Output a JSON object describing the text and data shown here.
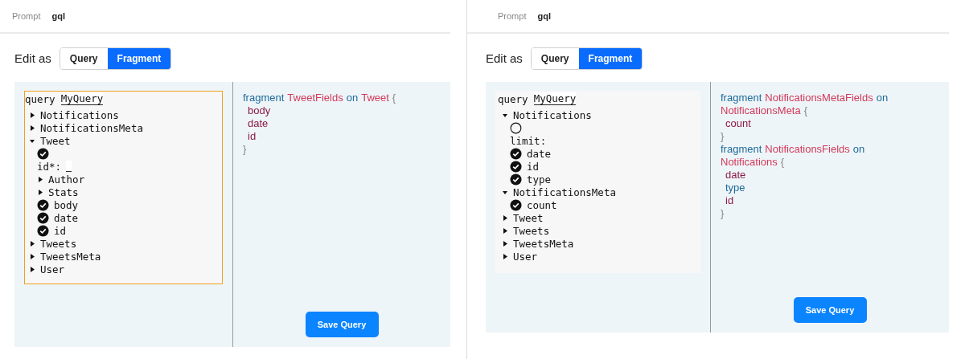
{
  "panels": [
    {
      "header": {
        "label": "Prompt",
        "value": "gql"
      },
      "edit_as": "Edit as",
      "tabs": [
        {
          "label": "Query",
          "selected": false
        },
        {
          "label": "Fragment",
          "selected": true
        }
      ],
      "explorer": {
        "keyword": "query",
        "name": "MyQuery",
        "focused": true,
        "nodes": [
          {
            "kind": "field",
            "label": "Notifications",
            "expanded": false
          },
          {
            "kind": "field",
            "label": "NotificationsMeta",
            "expanded": false
          },
          {
            "kind": "field",
            "label": "Tweet",
            "expanded": true,
            "children": [
              {
                "kind": "toggle",
                "checked": true
              },
              {
                "kind": "arg",
                "label": "id*:",
                "input": true
              },
              {
                "kind": "field",
                "label": "Author",
                "expanded": false
              },
              {
                "kind": "field",
                "label": "Stats",
                "expanded": false
              },
              {
                "kind": "leaf",
                "label": "body",
                "checked": true
              },
              {
                "kind": "leaf",
                "label": "date",
                "checked": true
              },
              {
                "kind": "leaf",
                "label": "id",
                "checked": true
              }
            ]
          },
          {
            "kind": "field",
            "label": "Tweets",
            "expanded": false
          },
          {
            "kind": "field",
            "label": "TweetsMeta",
            "expanded": false
          },
          {
            "kind": "field",
            "label": "User",
            "expanded": false
          }
        ]
      },
      "code": [
        [
          {
            "kind": "keyword",
            "text": "fragment"
          },
          {
            "kind": "name",
            "text": "TweetFields"
          },
          {
            "kind": "keyword",
            "text": "on"
          },
          {
            "kind": "name",
            "text": "Tweet"
          },
          {
            "kind": "punct",
            "text": "{"
          }
        ],
        [
          {
            "kind": "field",
            "text": "body"
          }
        ],
        [
          {
            "kind": "field",
            "text": "date"
          }
        ],
        [
          {
            "kind": "field",
            "text": "id"
          }
        ],
        [
          {
            "kind": "punct",
            "text": "}"
          }
        ]
      ],
      "save": "Save Query"
    },
    {
      "header": {
        "label": "Prompt",
        "value": "gql"
      },
      "edit_as": "Edit as",
      "tabs": [
        {
          "label": "Query",
          "selected": false
        },
        {
          "label": "Fragment",
          "selected": true
        }
      ],
      "explorer": {
        "keyword": "query",
        "name": "MyQuery",
        "focused": false,
        "nodes": [
          {
            "kind": "field",
            "label": "Notifications",
            "expanded": true,
            "children": [
              {
                "kind": "toggle",
                "checked": false
              },
              {
                "kind": "arg",
                "label": "limit:",
                "input": false
              },
              {
                "kind": "leaf",
                "label": "date",
                "checked": true
              },
              {
                "kind": "leaf",
                "label": "id",
                "checked": true
              },
              {
                "kind": "leaf",
                "label": "type",
                "checked": true
              }
            ]
          },
          {
            "kind": "field",
            "label": "NotificationsMeta",
            "expanded": true,
            "children": [
              {
                "kind": "leaf",
                "label": "count",
                "checked": true
              }
            ]
          },
          {
            "kind": "field",
            "label": "Tweet",
            "expanded": false
          },
          {
            "kind": "field",
            "label": "Tweets",
            "expanded": false
          },
          {
            "kind": "field",
            "label": "TweetsMeta",
            "expanded": false
          },
          {
            "kind": "field",
            "label": "User",
            "expanded": false
          }
        ]
      },
      "code": [
        [
          {
            "kind": "keyword",
            "text": "fragment"
          },
          {
            "kind": "name",
            "text": "NotificationsMetaFields"
          },
          {
            "kind": "keyword",
            "text": "on"
          }
        ],
        [
          {
            "kind": "name",
            "text": "NotificationsMeta"
          },
          {
            "kind": "punct",
            "text": "{"
          }
        ],
        [
          {
            "kind": "field",
            "text": "count"
          }
        ],
        [
          {
            "kind": "punct",
            "text": "}"
          }
        ],
        [
          {
            "kind": "keyword",
            "text": "fragment"
          },
          {
            "kind": "name",
            "text": "NotificationsFields"
          },
          {
            "kind": "keyword",
            "text": "on"
          }
        ],
        [
          {
            "kind": "name",
            "text": "Notifications"
          },
          {
            "kind": "punct",
            "text": "{"
          }
        ],
        [
          {
            "kind": "field",
            "text": "date"
          }
        ],
        [
          {
            "kind": "keyword",
            "text": "type"
          }
        ],
        [
          {
            "kind": "field",
            "text": "id"
          }
        ],
        [
          {
            "kind": "punct",
            "text": "}"
          }
        ]
      ],
      "save": "Save Query"
    }
  ]
}
